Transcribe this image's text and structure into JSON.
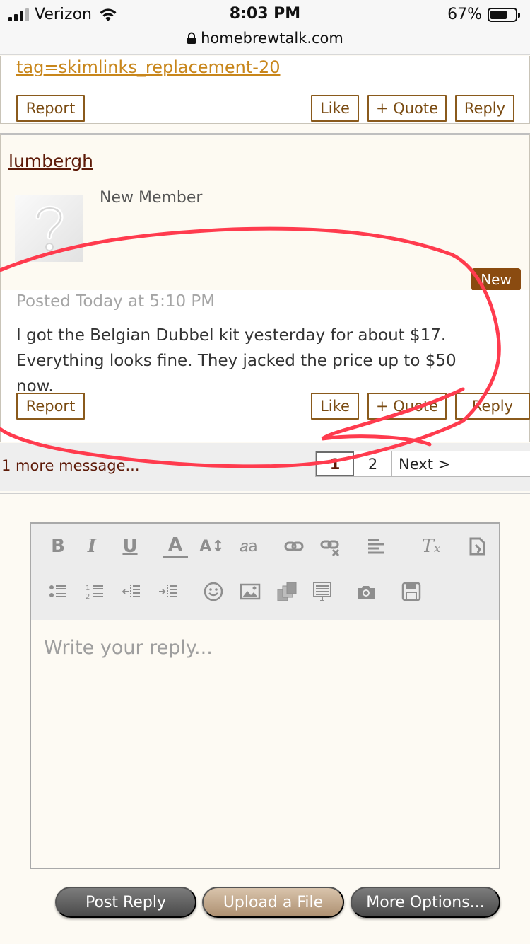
{
  "status_bar": {
    "carrier": "Verizon",
    "time": "8:03 PM",
    "battery": "67%",
    "battery_level": 0.67,
    "url": "homebrewtalk.com"
  },
  "previous_post": {
    "link_text": "tag=skimlinks_replacement-20",
    "buttons": {
      "report": "Report",
      "like": "Like",
      "quote": "+ Quote",
      "reply": "Reply"
    }
  },
  "post": {
    "username": "lumbergh",
    "member_title": "New Member",
    "badge": "New",
    "posted": "Posted Today at 5:10 PM",
    "body": "I got the Belgian Dubbel kit yesterday for about $17. Everything looks fine. They jacked the price up to $50 now.",
    "buttons": {
      "report": "Report",
      "like": "Like",
      "quote": "+ Quote",
      "reply": "Reply"
    }
  },
  "pagination": {
    "more_messages": "1 more message...",
    "pages": [
      "1",
      "2"
    ],
    "current": "1",
    "next": "Next >"
  },
  "reply_editor": {
    "placeholder": "Write your reply...",
    "toolbar_icons": [
      "bold-icon",
      "italic-icon",
      "underline-icon",
      "font-color-icon",
      "font-size-icon",
      "font-family-icon",
      "link-icon",
      "unlink-icon",
      "align-icon",
      "remove-format-icon",
      "toggle-bbcode-icon",
      "bullet-list-icon",
      "numbered-list-icon",
      "outdent-icon",
      "indent-icon",
      "smilie-icon",
      "image-icon",
      "media-icon",
      "insert-quote-icon",
      "camera-icon",
      "save-draft-icon"
    ]
  },
  "actions": {
    "post_reply": "Post Reply",
    "upload_file": "Upload a File",
    "more_options": "More Options..."
  },
  "colors": {
    "accent_brown": "#8a4b10",
    "link_orange": "#c8861b",
    "annotation_red": "#ff3b4e"
  }
}
